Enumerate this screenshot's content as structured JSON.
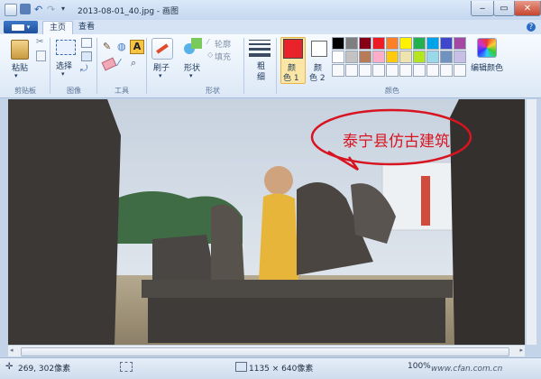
{
  "window": {
    "title": "2013-08-01_40.jpg - 画图",
    "controls": [
      "minimize-icon",
      "maximize-icon",
      "close-icon"
    ]
  },
  "tabs": [
    {
      "label": "主页",
      "active": true
    },
    {
      "label": "查看",
      "active": false
    }
  ],
  "ribbon": {
    "clipboard": {
      "paste_label": "粘贴",
      "group_label": "剪贴板"
    },
    "image": {
      "select_label": "选择",
      "group_label": "图像"
    },
    "tools": {
      "group_label": "工具"
    },
    "shapes": {
      "brush_label": "刷子",
      "shapes_label": "形状",
      "outline_label": "轮廓",
      "fill_label": "填充",
      "group_label": "形状"
    },
    "size": {
      "label_top": "粗",
      "label_bottom": "细"
    },
    "colors": {
      "color1_label_top": "颜",
      "color1_label_bottom": "色 1",
      "color2_label_top": "颜",
      "color2_label_bottom": "色 2",
      "edit_label": "编辑颜色",
      "group_label": "颜色",
      "color1": "#e8242a",
      "color2": "#ffffff",
      "palette_row1": [
        "#000000",
        "#7f7f7f",
        "#880015",
        "#ed1c24",
        "#ff7f27",
        "#fff200",
        "#22b14c",
        "#00a2e8",
        "#3f48cc",
        "#a349a4"
      ],
      "palette_row2": [
        "#ffffff",
        "#c3c3c3",
        "#b97a57",
        "#ffaec9",
        "#ffc90e",
        "#efe4b0",
        "#b5e61d",
        "#99d9ea",
        "#7092be",
        "#c8bfe7"
      ]
    }
  },
  "canvas": {
    "annotation_text": "泰宁县仿古建筑"
  },
  "status": {
    "cursor_pos": "269, 302像素",
    "image_size": "1135 × 640像素",
    "zoom": "100%",
    "watermark": "www.cfan.com.cn"
  }
}
